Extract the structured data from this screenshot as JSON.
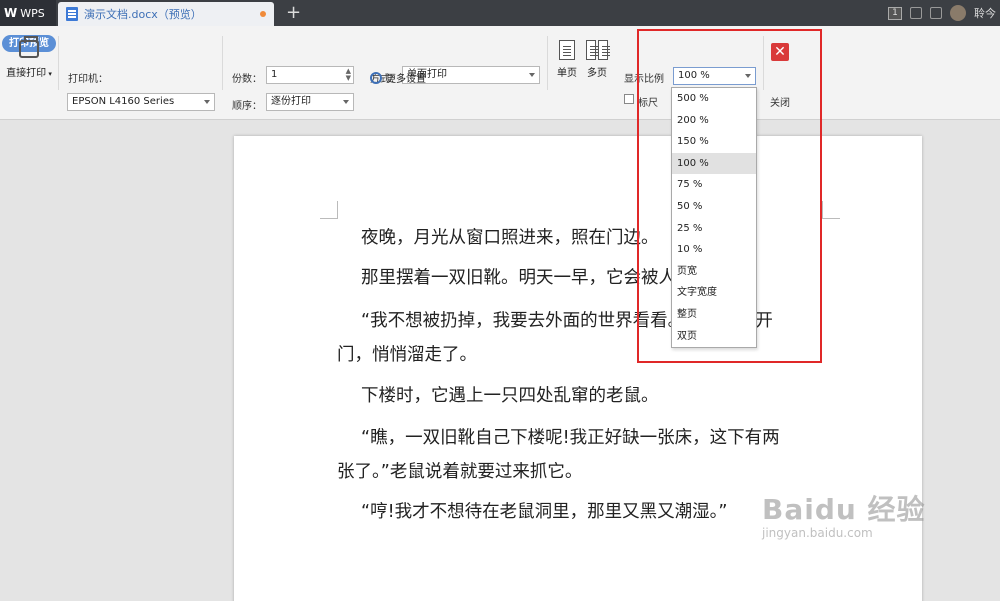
{
  "titlebar": {
    "app_name": "WPS",
    "doc_tab": "演示文档.docx（预览）",
    "new_tab": "+",
    "badge": "1",
    "user": "聆今"
  },
  "ribbon": {
    "mode_label": "打印预览",
    "direct_print": "直接打印",
    "printer_label": "打印机：",
    "printer_value": "EPSON L4160 Series",
    "copies_label": "份数：",
    "copies_value": "1",
    "order_label": "顺序：",
    "order_value": "逐份打印",
    "method_label": "方式：",
    "method_value": "单面打印",
    "more_settings": "更多设置",
    "single_page": "单页",
    "multi_page": "多页",
    "zoom_label": "显示比例",
    "zoom_value": "100 %",
    "ruler_label": "标尺",
    "close_label": "关闭"
  },
  "zoom_options": [
    "500 %",
    "200 %",
    "150 %",
    "100 %",
    "75 %",
    "50 %",
    "25 %",
    "10 %",
    "页宽",
    "文字宽度",
    "整页",
    "双页"
  ],
  "document": {
    "p1": "夜晚，月光从窗口照进来，照在门边。",
    "p2": "那里摆着一双旧靴。明天一早，它会被人拿去扔掉。",
    "p3a": "“我不想被扔掉，我要去外面的世界看看。”它轻轻打开",
    "p3b": "门，悄悄溜走了。",
    "p4": "下楼时，它遇上一只四处乱窜的老鼠。",
    "p5a": "“瞧，一双旧靴自己下楼呢!我正好缺一张床，这下有两",
    "p5b": "张了。”老鼠说着就要过来抓它。",
    "p6": "“哼!我才不想待在老鼠洞里，那里又黑又潮湿。”"
  },
  "watermark": {
    "title": "Baidu 经验",
    "url": "jingyan.baidu.com"
  },
  "colors": {
    "titlebar": "#3c3f44",
    "accent": "#5b8fd6",
    "highlight": "#e02828",
    "close": "#d93a3a"
  }
}
